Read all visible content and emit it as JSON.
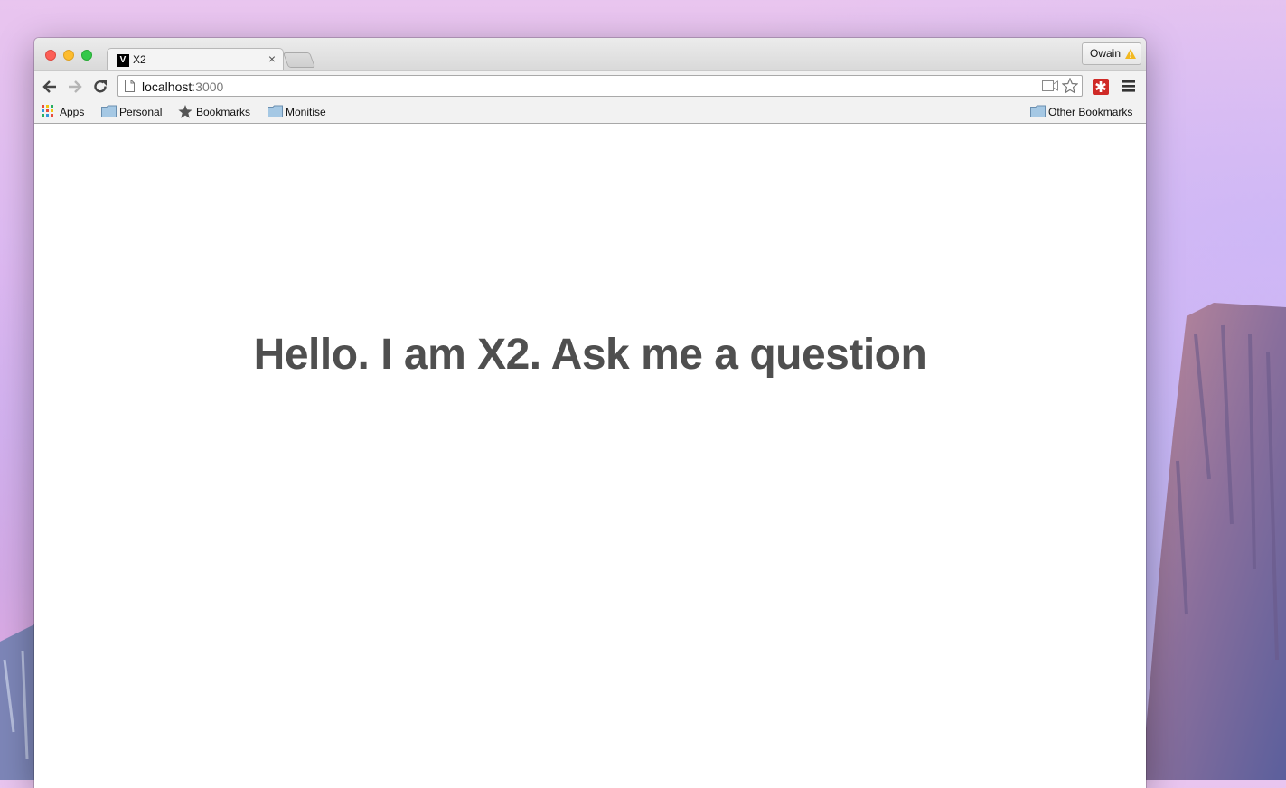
{
  "window": {
    "tab": {
      "favicon_letter": "V",
      "title": "X2",
      "close_glyph": "×"
    },
    "profile": {
      "name": "Owain",
      "warning_icon": "warning-icon"
    },
    "toolbar": {
      "url_host": "localhost",
      "url_port": ":3000",
      "icons": [
        "back-arrow-icon",
        "forward-arrow-icon",
        "reload-icon",
        "page-icon",
        "camera-icon",
        "star-icon",
        "lastpass-icon",
        "menu-icon"
      ]
    },
    "bookmarks": {
      "items": [
        {
          "label": "Apps",
          "icon": "apps-grid-icon"
        },
        {
          "label": "Personal",
          "icon": "folder-icon"
        },
        {
          "label": "Bookmarks",
          "icon": "star-icon"
        },
        {
          "label": "Monitise",
          "icon": "folder-icon"
        }
      ],
      "other": {
        "label": "Other Bookmarks",
        "icon": "folder-icon"
      }
    }
  },
  "page": {
    "headline": "Hello. I am X2. Ask me a question"
  },
  "colors": {
    "headline": "#4f4f4f",
    "close": "#fc5f57",
    "minimize": "#fdbc2e",
    "maximize": "#34c84a",
    "extension": "#cf2a27"
  }
}
